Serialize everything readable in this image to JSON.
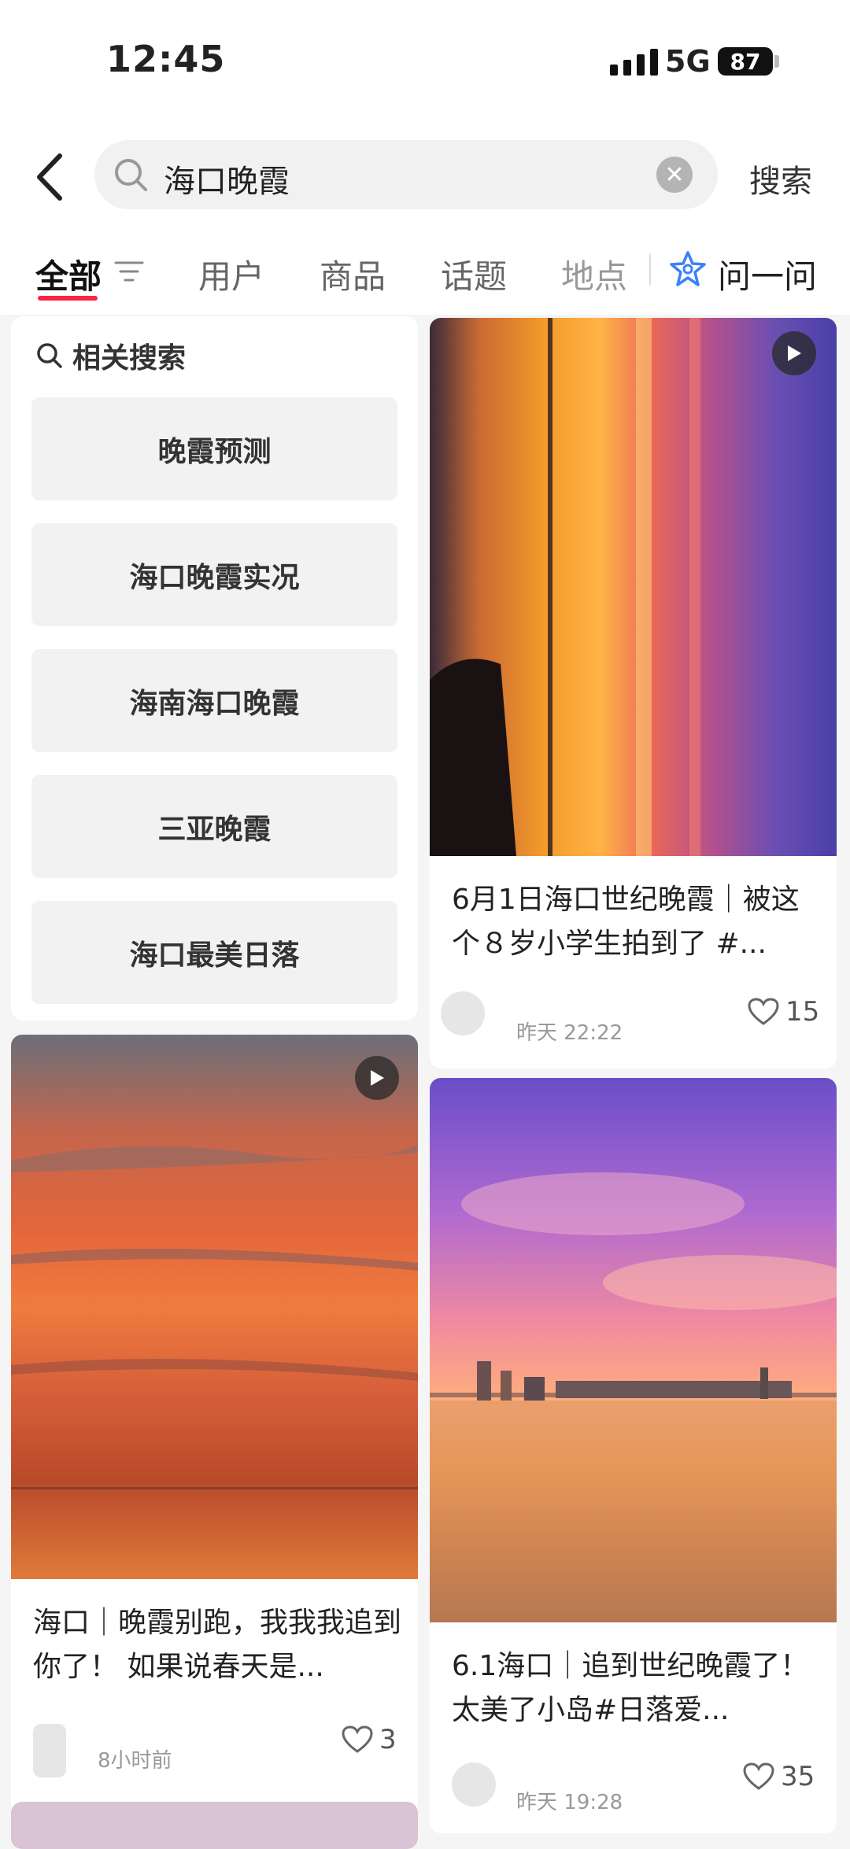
{
  "status": {
    "time": "12:45",
    "network": "5G",
    "battery": "87"
  },
  "search": {
    "query": "海口晚霞",
    "clear": "✕",
    "submit_label": "搜索"
  },
  "tabs": [
    {
      "label": "全部"
    },
    {
      "label": "用户"
    },
    {
      "label": "商品"
    },
    {
      "label": "话题"
    },
    {
      "label": "地点"
    }
  ],
  "ask": {
    "label": "问一问"
  },
  "related": {
    "title": "相关搜索",
    "items": [
      "晚霞预测",
      "海口晚霞实况",
      "海南海口晚霞",
      "三亚晚霞",
      "海口最美日落"
    ]
  },
  "posts": [
    {
      "title": "6月1日海口世纪晚霞｜被这个８岁小学生拍到了 #...",
      "time": "昨天 22:22",
      "likes": "15",
      "is_video": true
    },
    {
      "title": "海口｜晚霞别跑，我我我追到你了！ 如果说春天是...",
      "time": "8小时前",
      "likes": "3",
      "is_video": true
    },
    {
      "title": "6.1海口｜追到世纪晚霞了！ 太美了小岛#日落爱...",
      "time": "昨天 19:28",
      "likes": "35",
      "is_video": false
    }
  ],
  "colors": {
    "accent": "#ff2442"
  }
}
